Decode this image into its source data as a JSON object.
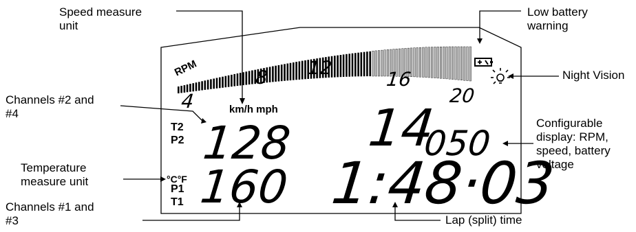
{
  "callouts": {
    "speed_unit": "Speed measure\nunit",
    "low_battery": "Low battery\nwarning",
    "night_vision": "Night Vision",
    "channels_24": "Channels #2 and\n#4",
    "configurable": "Configurable\ndisplay: RPM,\nspeed, battery\nvoltage",
    "temperature_unit": "Temperature\nmeasure unit",
    "channels_13": "Channels #1 and\n#3",
    "lap_time": "Lap (split) time"
  },
  "display": {
    "rpm_label": "RPM",
    "scale_4": "4",
    "scale_8": "8",
    "scale_12": "12",
    "scale_16": "16",
    "scale_20": "20",
    "speed_units": "km/h mph",
    "t2": "T2",
    "p2": "P2",
    "p1": "P1",
    "t1": "T1",
    "temp_units": "°C°F",
    "channel_upper_value": "128",
    "channel_lower_value": "160",
    "config_big": "14",
    "config_small": "050",
    "lap_time": "1:48·03"
  },
  "icons": [
    "battery-icon",
    "bulb-icon"
  ],
  "colors": {
    "lcd_ink": "#000000",
    "bar_light": "#bdbdbd",
    "outline": "#000000"
  }
}
